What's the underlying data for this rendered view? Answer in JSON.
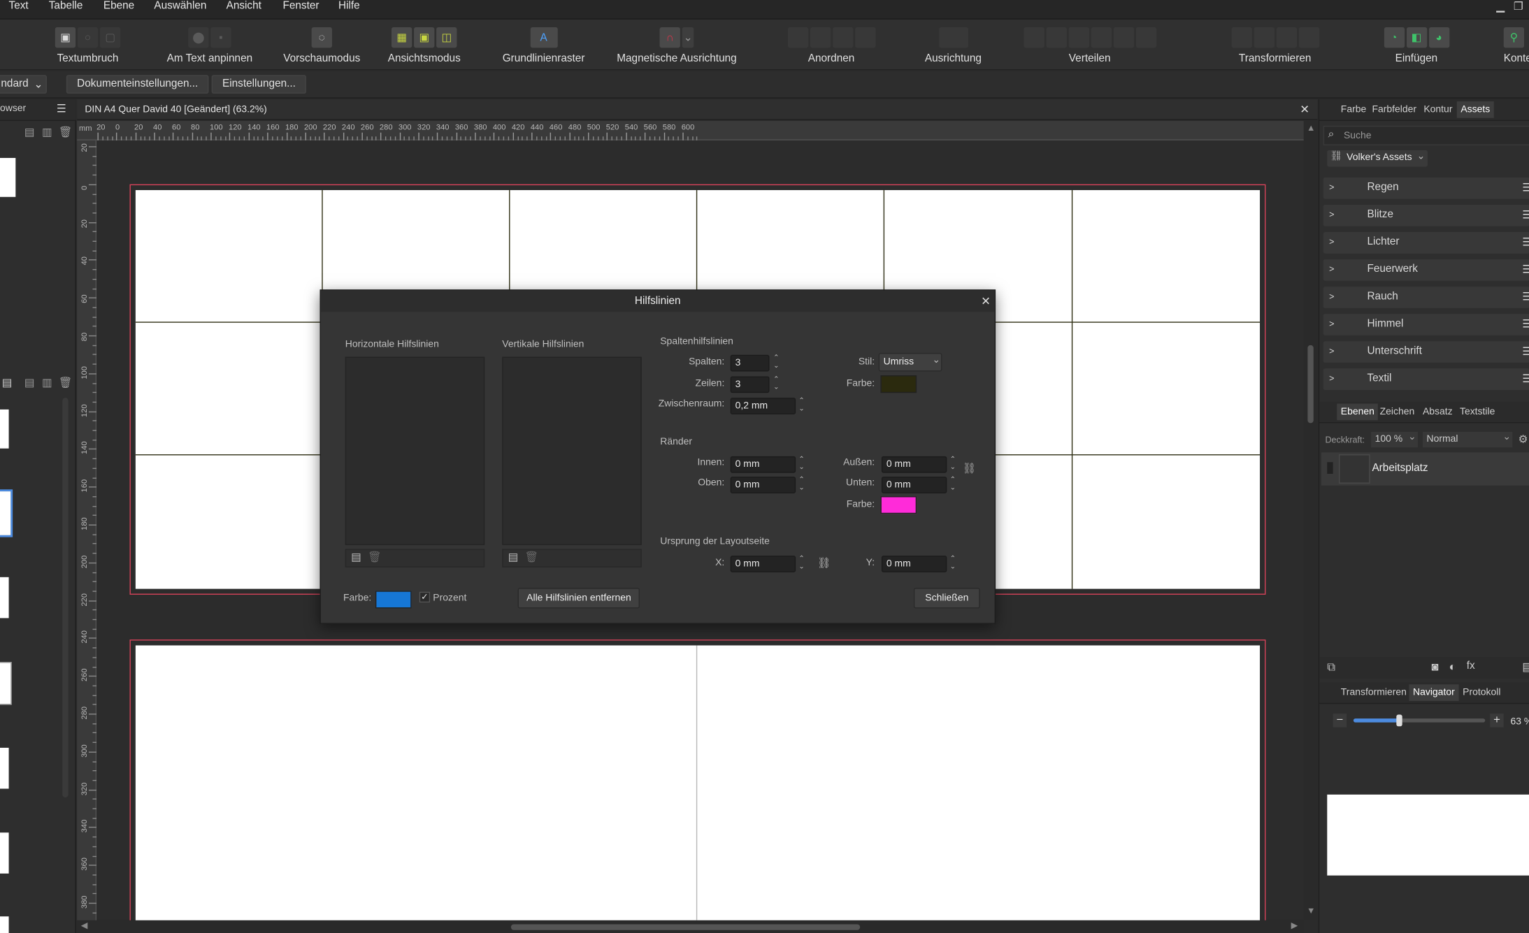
{
  "menubar": {
    "items": [
      "Text",
      "Tabelle",
      "Ebene",
      "Auswählen",
      "Ansicht",
      "Fenster",
      "Hilfe"
    ]
  },
  "window": {
    "minimize_icon": "minimize-icon",
    "restore_icon": "restore-icon"
  },
  "toolbar": {
    "groups": [
      {
        "label": "Textumbruch",
        "icons": [
          "textwrap-icon",
          "circle-icon",
          "square-icon"
        ]
      },
      {
        "label": "Am Text anpinnen",
        "icons": [
          "pin-icon",
          "anchor-icon"
        ]
      },
      {
        "label": "Vorschaumodus",
        "icons": [
          "preview-icon"
        ]
      },
      {
        "label": "Ansichtsmodus",
        "icons": [
          "view-normal-icon",
          "view-bleed-icon",
          "view-clip-icon"
        ]
      },
      {
        "label": "Grundlinienraster",
        "icons": [
          "baseline-grid-icon"
        ]
      },
      {
        "label": "Magnetische Ausrichtung",
        "icons": [
          "magnet-icon",
          "chevron-down-icon"
        ]
      },
      {
        "label": "Anordnen",
        "icons": [
          "arrange-1-icon",
          "arrange-2-icon",
          "arrange-3-icon",
          "arrange-4-icon"
        ]
      },
      {
        "label": "Ausrichtung",
        "icons": [
          "align-icon"
        ]
      },
      {
        "label": "Verteilen",
        "icons": [
          "dist-1-icon",
          "dist-2-icon",
          "dist-3-icon",
          "dist-4-icon",
          "dist-5-icon",
          "dist-6-icon"
        ]
      },
      {
        "label": "Transformieren",
        "icons": [
          "t1-icon",
          "t2-icon",
          "t3-icon",
          "t4-icon"
        ]
      },
      {
        "label": "Einfügen",
        "icons": [
          "insert-1-icon",
          "insert-2-icon",
          "insert-3-icon"
        ]
      },
      {
        "label": "Konte",
        "icons": [
          "user-icon"
        ]
      }
    ]
  },
  "context_bar": {
    "preset": "ndard",
    "doc_settings": "Dokumenteinstellungen...",
    "settings": "Einstellungen..."
  },
  "left_panel": {
    "title": "owser"
  },
  "document": {
    "tab_title": "DIN A4 Quer David 40 [Geändert] (63.2%)",
    "ruler_unit": "mm"
  },
  "ruler": {
    "h_ticks": [
      "20",
      "0",
      "20",
      "40",
      "60",
      "80",
      "100",
      "120",
      "140",
      "160",
      "180",
      "200",
      "220",
      "240",
      "260",
      "280",
      "300",
      "320",
      "340",
      "360",
      "380",
      "400",
      "420",
      "440",
      "460",
      "480",
      "500",
      "520",
      "540",
      "560",
      "580",
      "600"
    ],
    "v_ticks": [
      "20",
      "0",
      "20",
      "40",
      "60",
      "80",
      "100",
      "120",
      "140",
      "160",
      "180",
      "200",
      "220",
      "240",
      "260",
      "280",
      "300",
      "320",
      "340",
      "360",
      "380"
    ]
  },
  "right_panel": {
    "tabs": [
      "Farbe",
      "Farbfelder",
      "Kontur",
      "Assets"
    ],
    "search_placeholder": "Suche",
    "assets_dropdown": "Volker's Assets",
    "asset_categories": [
      "Regen",
      "Blitze",
      "Lichter",
      "Feuerwerk",
      "Rauch",
      "Himmel",
      "Unterschrift",
      "Textil"
    ],
    "layer_tabs": [
      "Ebenen",
      "Zeichen",
      "Absatz",
      "Textstile"
    ],
    "opacity_label": "Deckkraft:",
    "opacity_value": "100 %",
    "blend_mode": "Normal",
    "layer_name": "Arbeitsplatz",
    "nav_tabs": [
      "Transformieren",
      "Navigator",
      "Protokoll"
    ],
    "zoom_value": "63 %",
    "zoom_fraction": 0.35
  },
  "dialog": {
    "title": "Hilfslinien",
    "horizontal_label": "Horizontale Hilfslinien",
    "vertical_label": "Vertikale Hilfslinien",
    "column_guides_label": "Spaltenhilfslinien",
    "columns_label": "Spalten:",
    "columns_value": "3",
    "rows_label": "Zeilen:",
    "rows_value": "3",
    "gutter_label": "Zwischenraum:",
    "gutter_value": "0,2 mm",
    "style_label": "Stil:",
    "style_value": "Umriss",
    "color_label": "Farbe:",
    "guide_color": "#2b2a0e",
    "margins_label": "Ränder",
    "inner_label": "Innen:",
    "inner_value": "0 mm",
    "top_label": "Oben:",
    "top_value": "0 mm",
    "outer_label": "Außen:",
    "outer_value": "0 mm",
    "bottom_label": "Unten:",
    "bottom_value": "0 mm",
    "margin_color_label": "Farbe:",
    "margin_color": "#ff2bd9",
    "origin_label": "Ursprung der Layoutseite",
    "x_label": "X:",
    "x_value": "0 mm",
    "y_label": "Y:",
    "y_value": "0 mm",
    "bottom_color_label": "Farbe:",
    "bottom_color": "#1677d6",
    "percent_label": "Prozent",
    "percent_checked": true,
    "remove_all": "Alle Hilfslinien entfernen",
    "close_button": "Schließen"
  },
  "colors": {
    "page_border": "#d6435a",
    "accent_blue": "#1677d6"
  }
}
